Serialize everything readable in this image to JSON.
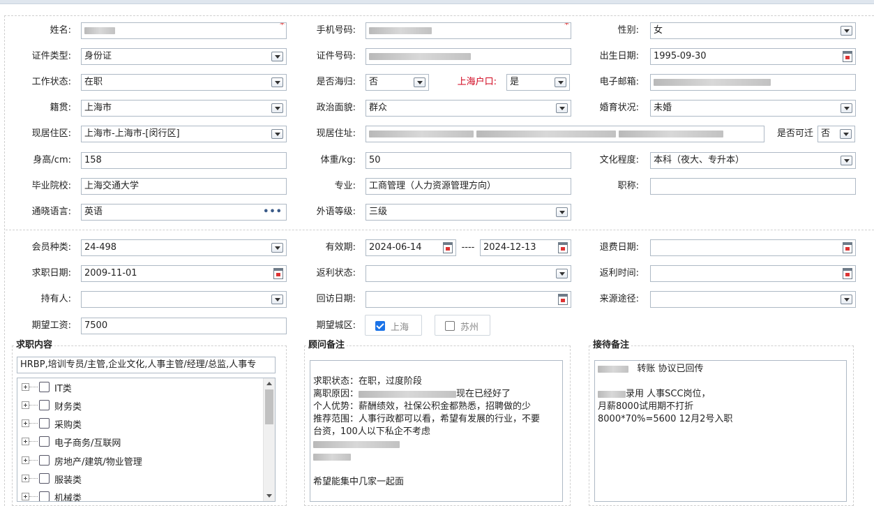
{
  "required_mark": "*",
  "basic": {
    "name": {
      "label": "姓名:"
    },
    "phone": {
      "label": "手机号码:"
    },
    "gender": {
      "label": "性别:",
      "value": "女"
    },
    "id_type": {
      "label": "证件类型:",
      "value": "身份证"
    },
    "id_number": {
      "label": "证件号码:"
    },
    "birth_date": {
      "label": "出生日期:",
      "value": "1995-09-30"
    },
    "work_status": {
      "label": "工作状态:",
      "value": "在职"
    },
    "returnee": {
      "label": "是否海归:",
      "value": "否"
    },
    "shanghai_hukou": {
      "label": "上海户口:",
      "value": "是"
    },
    "email": {
      "label": "电子邮箱:"
    },
    "native_place": {
      "label": "籍贯:",
      "value": "上海市"
    },
    "political": {
      "label": "政治面貌:",
      "value": "群众"
    },
    "marital": {
      "label": "婚育状况:",
      "value": "未婚"
    },
    "residence_area": {
      "label": "现居住区:",
      "value": "上海市-上海市-[闵行区]"
    },
    "residence_address": {
      "label": "现居住址:"
    },
    "relocatable": {
      "label": "是否可迁",
      "value": "否"
    },
    "height": {
      "label": "身高/cm:",
      "value": "158"
    },
    "weight": {
      "label": "体重/kg:",
      "value": "50"
    },
    "education": {
      "label": "文化程度:",
      "value": "本科（夜大、专升本）"
    },
    "school": {
      "label": "毕业院校:",
      "value": "上海交通大学"
    },
    "major": {
      "label": "专业:",
      "value": "工商管理（人力资源管理方向）"
    },
    "title": {
      "label": "职称:",
      "value": ""
    },
    "languages": {
      "label": "通晓语言:",
      "value": "英语"
    },
    "language_level": {
      "label": "外语等级:",
      "value": "三级"
    }
  },
  "membership": {
    "member_type": {
      "label": "会员种类:",
      "value": "24-498"
    },
    "valid_period": {
      "label": "有效期:",
      "from": "2024-06-14",
      "separator": "----",
      "to": "2024-12-13"
    },
    "refund_date": {
      "label": "退费日期:",
      "value": ""
    },
    "job_seek_date": {
      "label": "求职日期:",
      "value": "2009-11-01"
    },
    "rebate_status": {
      "label": "返利状态:",
      "value": ""
    },
    "rebate_time": {
      "label": "返利时间:",
      "value": ""
    },
    "holder": {
      "label": "持有人:",
      "value": ""
    },
    "revisit_date": {
      "label": "回访日期:",
      "value": ""
    },
    "source": {
      "label": "来源途径:",
      "value": ""
    },
    "expected_salary": {
      "label": "期望工资:",
      "value": "7500"
    },
    "expected_city": {
      "label": "期望城区:",
      "options": [
        {
          "label": "上海",
          "checked": true
        },
        {
          "label": "苏州",
          "checked": false
        }
      ]
    }
  },
  "job_content": {
    "title": "求职内容",
    "summary": "HRBP,培训专员/主管,企业文化,人事主管/经理/总监,人事专",
    "categories": [
      "IT类",
      "财务类",
      "采购类",
      "电子商务/互联网",
      "房地产/建筑/物业管理",
      "服装类",
      "机械类"
    ]
  },
  "consultant_notes": {
    "title": "顾问备注",
    "lines": [
      "",
      "求职状态：在职，过度阶段",
      "离职原因：",
      "现在已经好了",
      "个人优势：薪酬绩效，社保公积金都熟悉，招聘做的少",
      "推荐范围：人事行政都可以看，希望有发展的行业，不要",
      "台资，100人以下私企不考虑",
      "",
      "",
      "",
      "希望能集中几家一起面"
    ]
  },
  "reception_notes": {
    "title": "接待备注",
    "lines": [
      "转账    协议已回传",
      "",
      "录用  人事SCC岗位，",
      "月薪8000试用期不打折",
      "8000*70%=5600   12月2号入职"
    ]
  },
  "icons": {
    "dropdown": "chevron-down-icon",
    "calendar": "calendar-icon",
    "more": "more-dots-icon",
    "expand": "plus-box-icon"
  },
  "colors": {
    "border": "#aeb9c5",
    "required": "#e02020",
    "hukou_label": "#d0021b",
    "checkbox_checked": "#1a73e8"
  }
}
